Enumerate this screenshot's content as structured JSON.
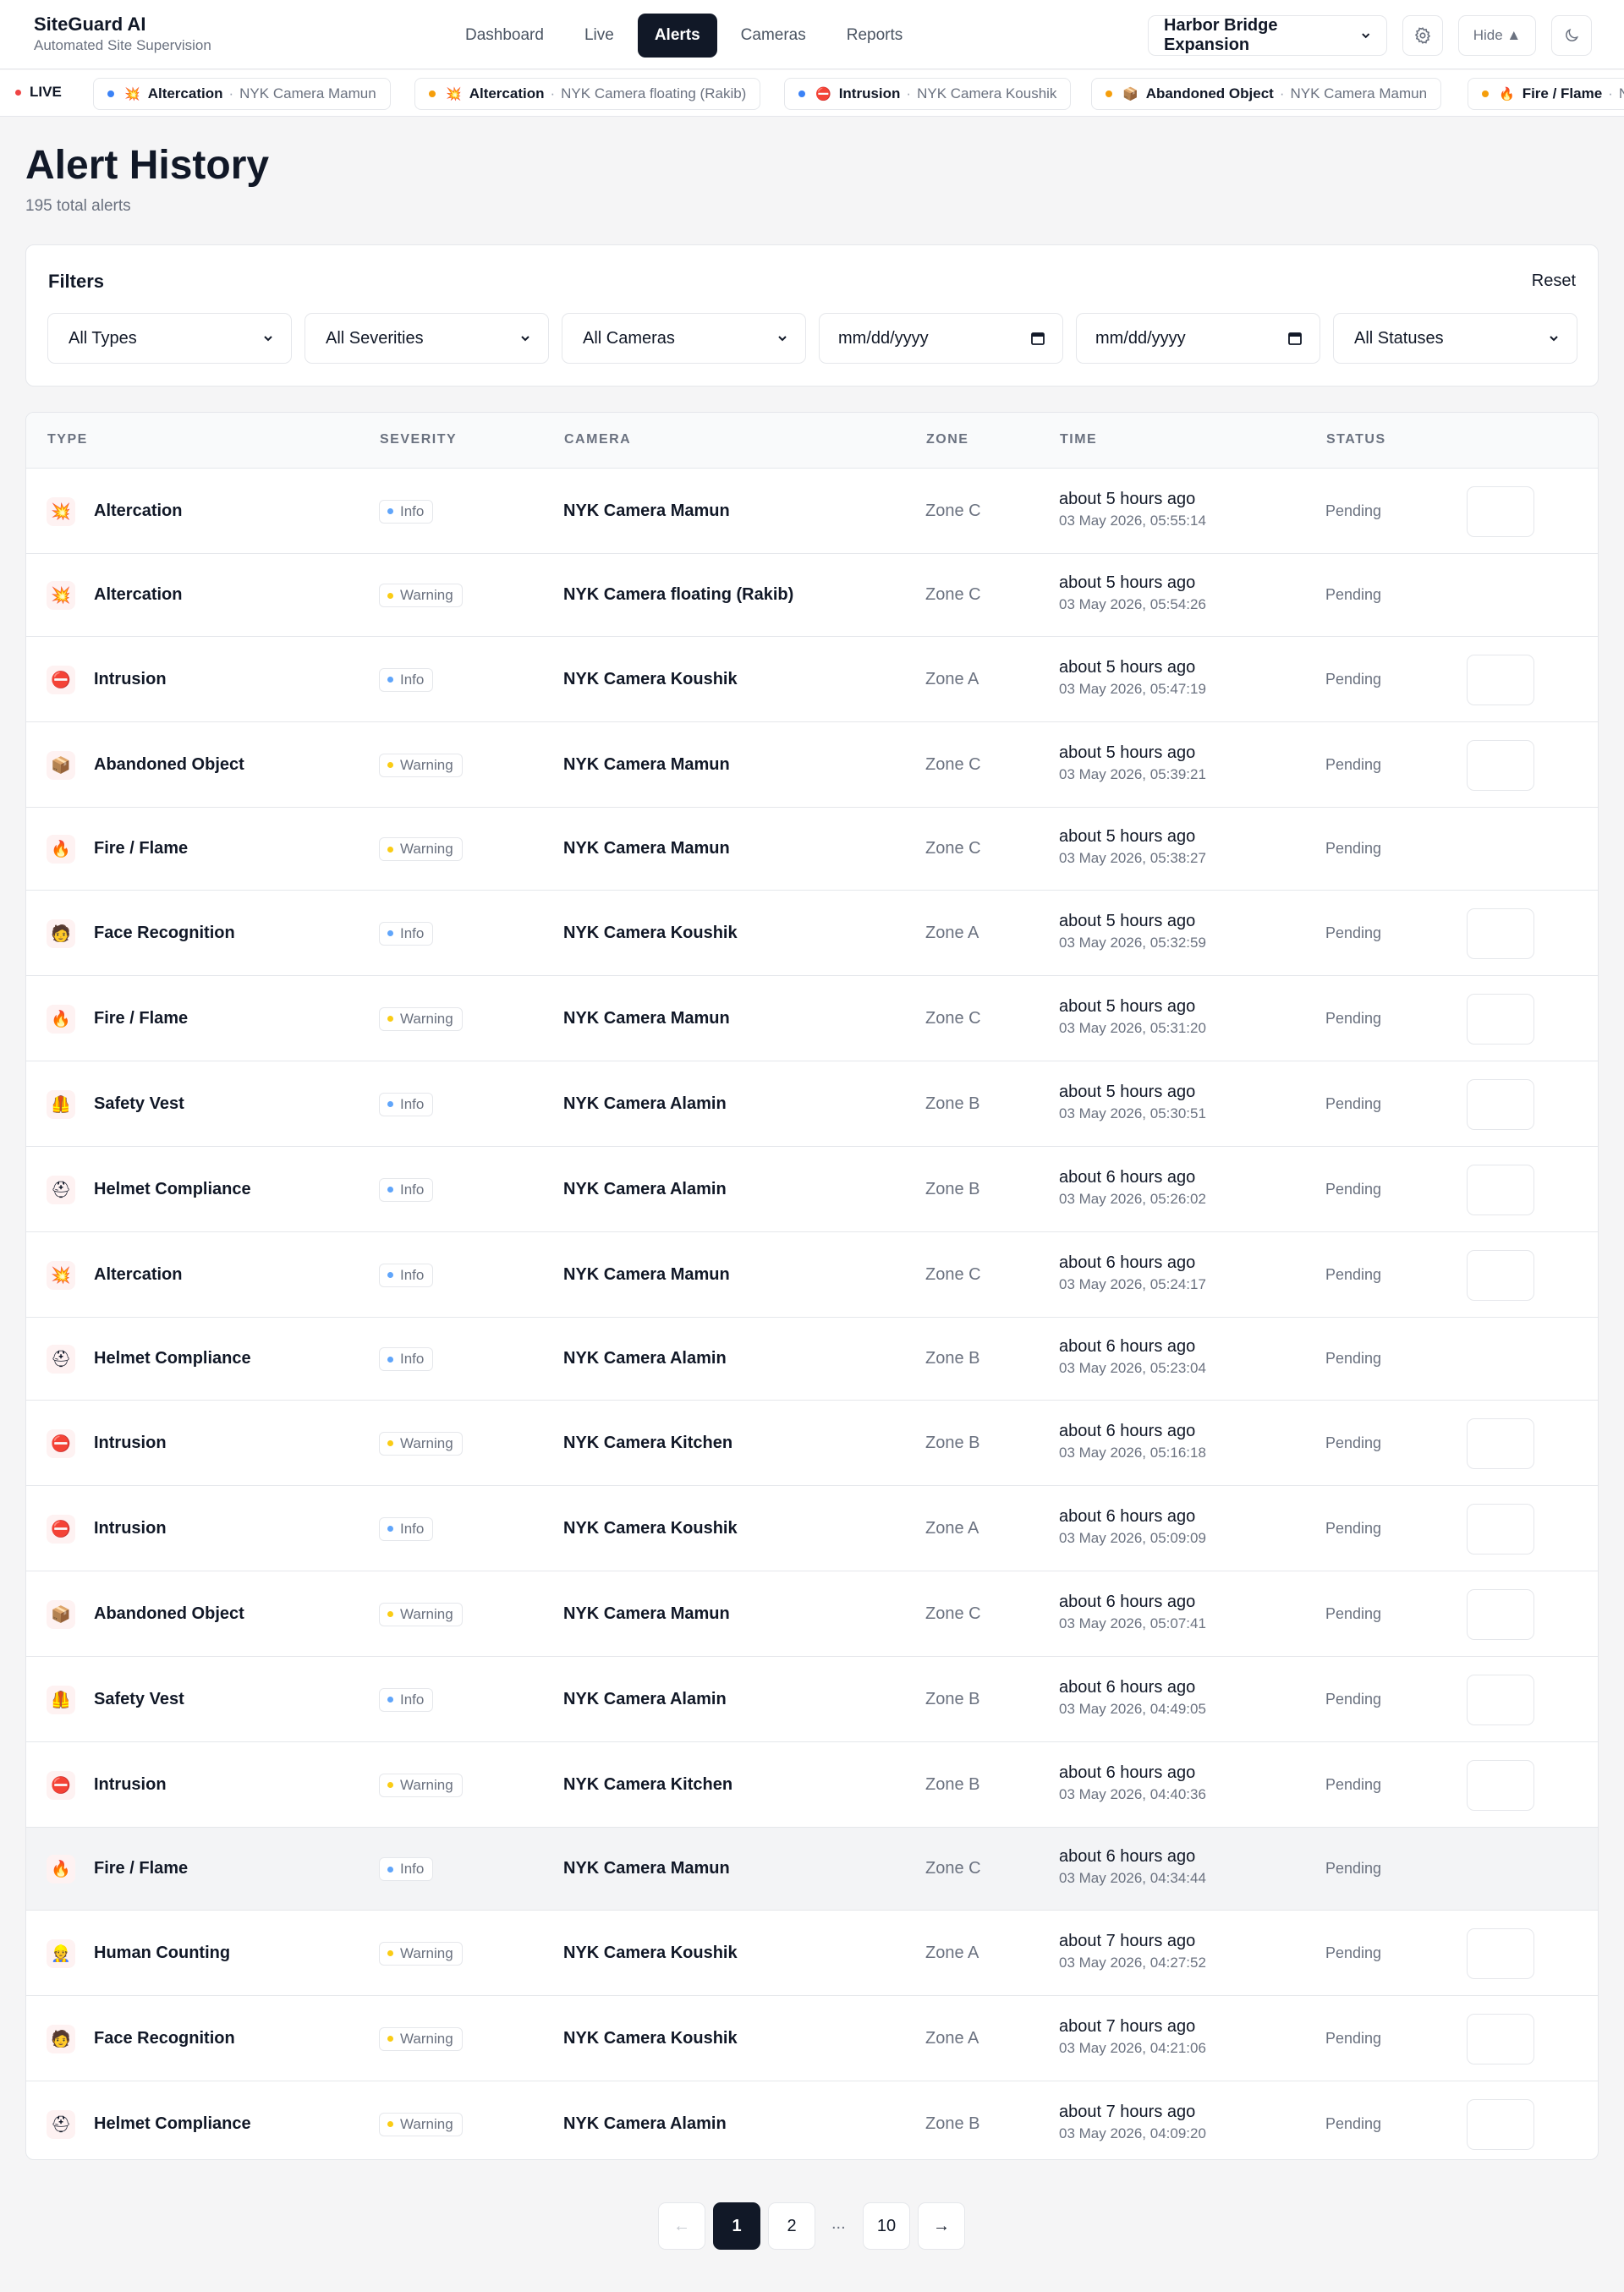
{
  "app": {
    "name": "SiteGuard AI",
    "subtitle": "Automated Site Supervision"
  },
  "nav": [
    {
      "label": "Dashboard",
      "active": false
    },
    {
      "label": "Live",
      "active": false
    },
    {
      "label": "Alerts",
      "active": true
    },
    {
      "label": "Cameras",
      "active": false
    },
    {
      "label": "Reports",
      "active": false
    }
  ],
  "header": {
    "project": "Harbor Bridge Expansion",
    "hide_label": "Hide ▲"
  },
  "ticker": {
    "live_label": "LIVE",
    "items": [
      {
        "type": "Altercation",
        "camera": "NYK Camera Mamun",
        "dot": "#3b82f6",
        "icon": "💥"
      },
      {
        "type": "Altercation",
        "camera": "NYK Camera floating (Rakib)",
        "dot": "#f59e0b",
        "icon": "💥"
      },
      {
        "type": "Intrusion",
        "camera": "NYK Camera Koushik",
        "dot": "#3b82f6",
        "icon": "⛔"
      },
      {
        "type": "Abandoned Object",
        "camera": "NYK Camera Mamun",
        "dot": "#f59e0b",
        "icon": "📦"
      },
      {
        "type": "Fire / Flame",
        "camera": "NYK Camera Mamun",
        "dot": "#f59e0b",
        "icon": "🔥"
      }
    ]
  },
  "page": {
    "title": "Alert History",
    "subtitle": "195 total alerts"
  },
  "filters": {
    "title": "Filters",
    "reset": "Reset",
    "type": "All Types",
    "severity": "All Severities",
    "camera": "All Cameras",
    "date_from": "mm/dd/yyyy",
    "date_to": "mm/dd/yyyy",
    "status": "All Statuses"
  },
  "table": {
    "columns": [
      "TYPE",
      "SEVERITY",
      "CAMERA",
      "ZONE",
      "TIME",
      "STATUS"
    ],
    "rows": [
      {
        "type": "Altercation",
        "icon": "💥",
        "severity": "Info",
        "camera": "NYK Camera Mamun",
        "zone": "Zone C",
        "rel": "about 5 hours ago",
        "abs": "03 May 2026, 05:55:14",
        "status": "Pending",
        "action": true
      },
      {
        "type": "Altercation",
        "icon": "💥",
        "severity": "Warning",
        "camera": "NYK Camera floating (Rakib)",
        "zone": "Zone C",
        "rel": "about 5 hours ago",
        "abs": "03 May 2026, 05:54:26",
        "status": "Pending",
        "action": false
      },
      {
        "type": "Intrusion",
        "icon": "⛔",
        "severity": "Info",
        "camera": "NYK Camera Koushik",
        "zone": "Zone A",
        "rel": "about 5 hours ago",
        "abs": "03 May 2026, 05:47:19",
        "status": "Pending",
        "action": true
      },
      {
        "type": "Abandoned Object",
        "icon": "📦",
        "severity": "Warning",
        "camera": "NYK Camera Mamun",
        "zone": "Zone C",
        "rel": "about 5 hours ago",
        "abs": "03 May 2026, 05:39:21",
        "status": "Pending",
        "action": true
      },
      {
        "type": "Fire / Flame",
        "icon": "🔥",
        "severity": "Warning",
        "camera": "NYK Camera Mamun",
        "zone": "Zone C",
        "rel": "about 5 hours ago",
        "abs": "03 May 2026, 05:38:27",
        "status": "Pending",
        "action": false
      },
      {
        "type": "Face Recognition",
        "icon": "🧑",
        "severity": "Info",
        "camera": "NYK Camera Koushik",
        "zone": "Zone A",
        "rel": "about 5 hours ago",
        "abs": "03 May 2026, 05:32:59",
        "status": "Pending",
        "action": true
      },
      {
        "type": "Fire / Flame",
        "icon": "🔥",
        "severity": "Warning",
        "camera": "NYK Camera Mamun",
        "zone": "Zone C",
        "rel": "about 5 hours ago",
        "abs": "03 May 2026, 05:31:20",
        "status": "Pending",
        "action": true
      },
      {
        "type": "Safety Vest",
        "icon": "🦺",
        "severity": "Info",
        "camera": "NYK Camera Alamin",
        "zone": "Zone B",
        "rel": "about 5 hours ago",
        "abs": "03 May 2026, 05:30:51",
        "status": "Pending",
        "action": true
      },
      {
        "type": "Helmet Compliance",
        "icon": "⛑",
        "severity": "Info",
        "camera": "NYK Camera Alamin",
        "zone": "Zone B",
        "rel": "about 6 hours ago",
        "abs": "03 May 2026, 05:26:02",
        "status": "Pending",
        "action": true
      },
      {
        "type": "Altercation",
        "icon": "💥",
        "severity": "Info",
        "camera": "NYK Camera Mamun",
        "zone": "Zone C",
        "rel": "about 6 hours ago",
        "abs": "03 May 2026, 05:24:17",
        "status": "Pending",
        "action": true
      },
      {
        "type": "Helmet Compliance",
        "icon": "⛑",
        "severity": "Info",
        "camera": "NYK Camera Alamin",
        "zone": "Zone B",
        "rel": "about 6 hours ago",
        "abs": "03 May 2026, 05:23:04",
        "status": "Pending",
        "action": false
      },
      {
        "type": "Intrusion",
        "icon": "⛔",
        "severity": "Warning",
        "camera": "NYK Camera Kitchen",
        "zone": "Zone B",
        "rel": "about 6 hours ago",
        "abs": "03 May 2026, 05:16:18",
        "status": "Pending",
        "action": true
      },
      {
        "type": "Intrusion",
        "icon": "⛔",
        "severity": "Info",
        "camera": "NYK Camera Koushik",
        "zone": "Zone A",
        "rel": "about 6 hours ago",
        "abs": "03 May 2026, 05:09:09",
        "status": "Pending",
        "action": true
      },
      {
        "type": "Abandoned Object",
        "icon": "📦",
        "severity": "Warning",
        "camera": "NYK Camera Mamun",
        "zone": "Zone C",
        "rel": "about 6 hours ago",
        "abs": "03 May 2026, 05:07:41",
        "status": "Pending",
        "action": true
      },
      {
        "type": "Safety Vest",
        "icon": "🦺",
        "severity": "Info",
        "camera": "NYK Camera Alamin",
        "zone": "Zone B",
        "rel": "about 6 hours ago",
        "abs": "03 May 2026, 04:49:05",
        "status": "Pending",
        "action": true
      },
      {
        "type": "Intrusion",
        "icon": "⛔",
        "severity": "Warning",
        "camera": "NYK Camera Kitchen",
        "zone": "Zone B",
        "rel": "about 6 hours ago",
        "abs": "03 May 2026, 04:40:36",
        "status": "Pending",
        "action": true
      },
      {
        "type": "Fire / Flame",
        "icon": "🔥",
        "severity": "Info",
        "camera": "NYK Camera Mamun",
        "zone": "Zone C",
        "rel": "about 6 hours ago",
        "abs": "03 May 2026, 04:34:44",
        "status": "Pending",
        "action": false,
        "highlight": true
      },
      {
        "type": "Human Counting",
        "icon": "👷",
        "severity": "Warning",
        "camera": "NYK Camera Koushik",
        "zone": "Zone A",
        "rel": "about 7 hours ago",
        "abs": "03 May 2026, 04:27:52",
        "status": "Pending",
        "action": true
      },
      {
        "type": "Face Recognition",
        "icon": "🧑",
        "severity": "Warning",
        "camera": "NYK Camera Koushik",
        "zone": "Zone A",
        "rel": "about 7 hours ago",
        "abs": "03 May 2026, 04:21:06",
        "status": "Pending",
        "action": true
      },
      {
        "type": "Helmet Compliance",
        "icon": "⛑",
        "severity": "Warning",
        "camera": "NYK Camera Alamin",
        "zone": "Zone B",
        "rel": "about 7 hours ago",
        "abs": "03 May 2026, 04:09:20",
        "status": "Pending",
        "action": true
      }
    ]
  },
  "pagination": {
    "prev": "←",
    "pages": [
      "1",
      "2",
      "10"
    ],
    "ellipsis": "...",
    "next": "→",
    "current": "1"
  },
  "colors": {
    "info": "#60a5fa",
    "warning": "#facc15",
    "accent": "#111827"
  }
}
